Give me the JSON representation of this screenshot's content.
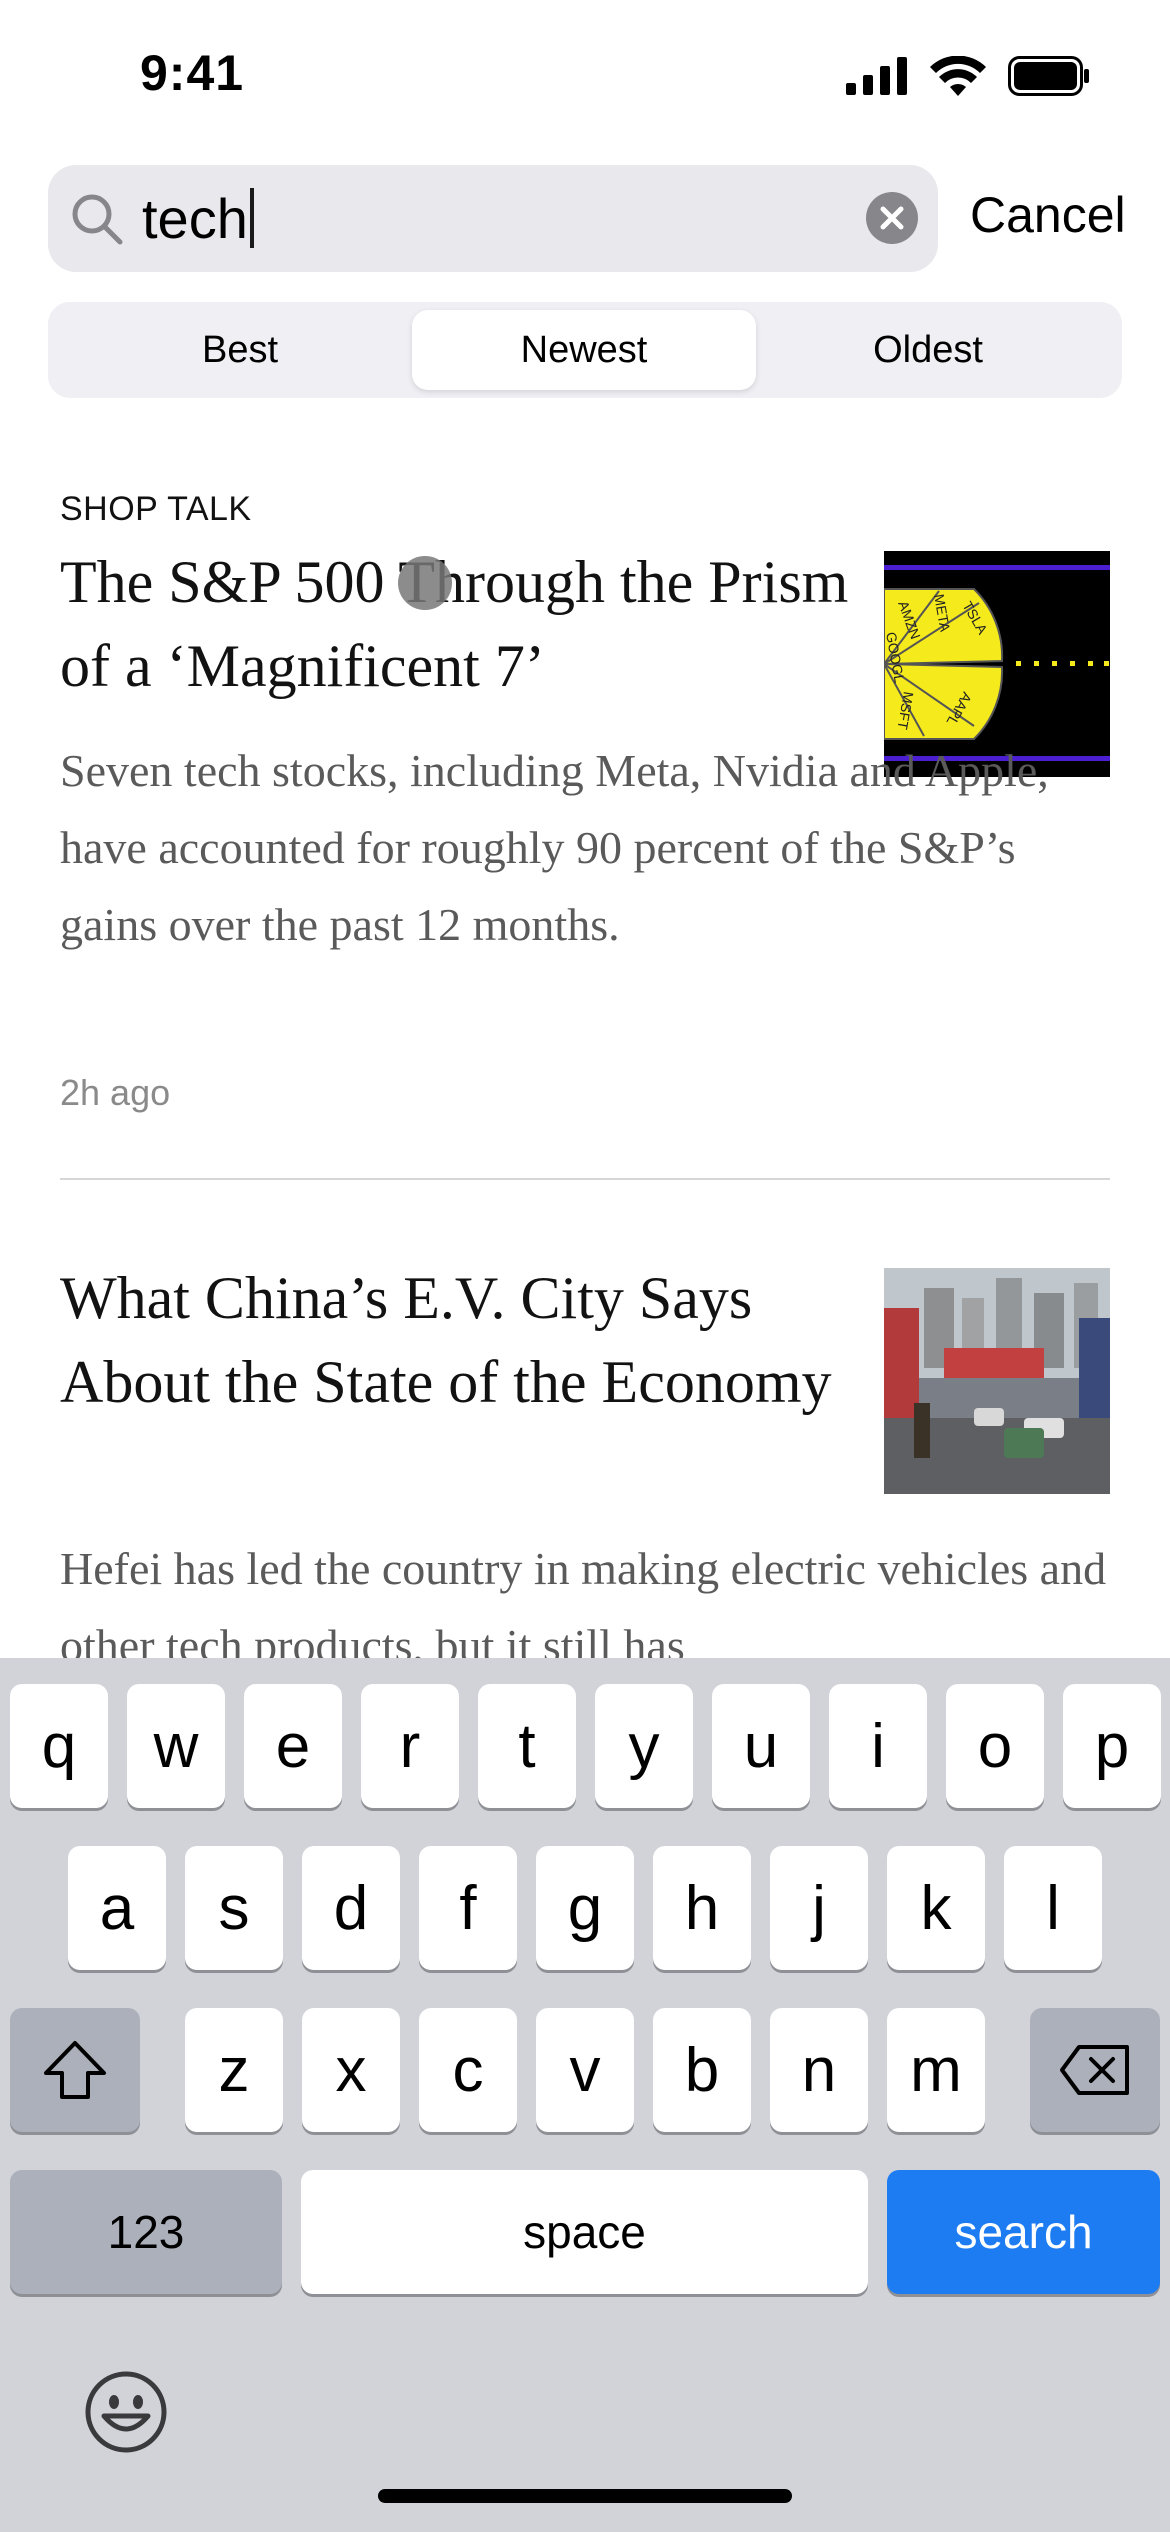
{
  "status_bar": {
    "time": "9:41"
  },
  "search": {
    "query": "tech",
    "cancel_label": "Cancel"
  },
  "sort": {
    "options": [
      "Best",
      "Newest",
      "Oldest"
    ],
    "selected": "Newest"
  },
  "articles": [
    {
      "kicker": "SHOP TALK",
      "headline": "The S&P 500 Through the Prism of a ‘Magnificent 7’",
      "summary": "Seven tech stocks, including Meta, Nvidia and Apple, have accounted for roughly 90 percent of the S&P’s gains over the past 12 months.",
      "timestamp": "2h ago",
      "thumbnail_labels": [
        "AMZN",
        "META",
        "TSLA",
        "GOOGL",
        "MSFT",
        "AAPL"
      ]
    },
    {
      "headline": "What China’s E.V. City Says About the State of the Economy",
      "summary": "Hefei has led the country in making electric vehicles and other tech products, but it still has"
    }
  ],
  "keyboard": {
    "row1": [
      "q",
      "w",
      "e",
      "r",
      "t",
      "y",
      "u",
      "i",
      "o",
      "p"
    ],
    "row2": [
      "a",
      "s",
      "d",
      "f",
      "g",
      "h",
      "j",
      "k",
      "l"
    ],
    "row3": [
      "z",
      "x",
      "c",
      "v",
      "b",
      "n",
      "m"
    ],
    "numbers_label": "123",
    "space_label": "space",
    "search_label": "search"
  },
  "colors": {
    "accent": "#1e7cf2",
    "keyboard_bg": "#d1d3d9"
  }
}
